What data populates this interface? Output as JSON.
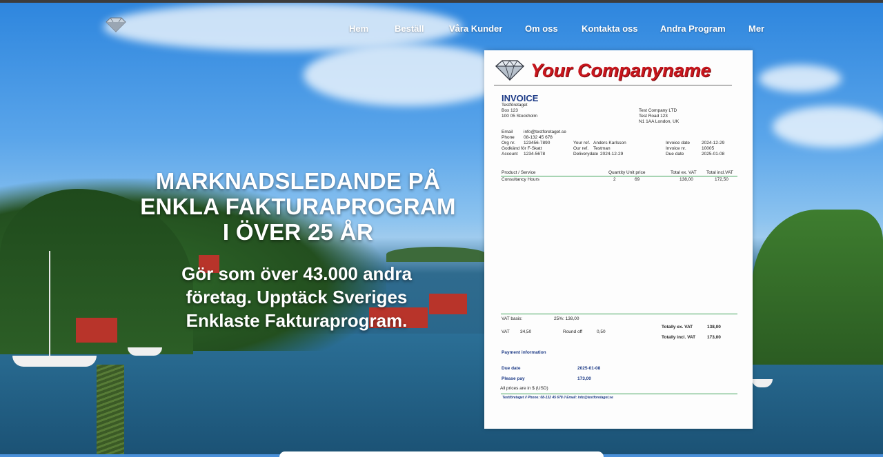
{
  "nav": {
    "items": [
      "Hem",
      "Beställ",
      "Våra Kunder",
      "Om oss",
      "Kontakta oss",
      "Andra Program",
      "Mer"
    ]
  },
  "hero": {
    "headline_lines": [
      "MARKNADSLEDANDE PÅ",
      "ENKLA FAKTURAPROGRAM",
      "I ÖVER 25 ÅR"
    ],
    "sub_lines": [
      "Gör som över 43.000 andra",
      "företag. Upptäck Sveriges",
      "Enklaste Fakturaprogram."
    ]
  },
  "invoice": {
    "company": "Your Companyname",
    "title": "INVOICE",
    "sender": [
      "Testföretaget",
      "Box 123",
      "100 05 Stockholm"
    ],
    "recipient": [
      "Test Company LTD",
      "Test Road 123",
      "N1 1AA London, UK"
    ],
    "contact_labels": [
      "Email",
      "Phone",
      "Org nr.",
      "Godkänd för F-Skatt",
      "Account"
    ],
    "contact_values": [
      "info@testforetaget.se",
      "08-132 45 678",
      "123456-7890",
      "",
      "1234-5678"
    ],
    "refs": [
      {
        "label": "Your ref.",
        "value": "Anders Karlsson"
      },
      {
        "label": "Our ref.",
        "value": "Testman"
      },
      {
        "label": "Deliverydate",
        "value": "2024-12-29"
      }
    ],
    "dates": [
      {
        "label": "Invoice date",
        "value": "2024-12-29"
      },
      {
        "label": "Invoice nr.",
        "value": "10005"
      },
      {
        "label": "Due date",
        "value": "2025-01-08"
      }
    ],
    "table_headers": {
      "product": "Product / Service",
      "quantity": "Quantity",
      "unit_price": "Unit price",
      "total_ex": "Total ex. VAT",
      "total_incl": "Total incl.VAT"
    },
    "rows": [
      {
        "product": "Consultancy Hours",
        "quantity": "2",
        "unit_price": "69",
        "total_ex": "138,00",
        "total_incl": "172,50"
      }
    ],
    "vat_basis_label": "VAT basis:",
    "vat_basis_value": "25%: 138,00",
    "vat_label": "VAT",
    "vat_value": "34,50",
    "roundoff_label": "Round off",
    "roundoff_value": "0,50",
    "totally_ex_label": "Totally ex. VAT",
    "totally_ex_value": "138,00",
    "totally_incl_label": "Totally incl. VAT",
    "totally_incl_value": "173,00",
    "payment_info": "Payment information",
    "due_date_label": "Due date",
    "due_date_value": "2025-01-08",
    "please_pay_label": "Please pay",
    "please_pay_value": "173,00",
    "currency_note": "All prices are in $ (USD)",
    "footer": "Testföretaget // Phone: 08-132 45 678 // Email: info@testforetaget.se"
  }
}
